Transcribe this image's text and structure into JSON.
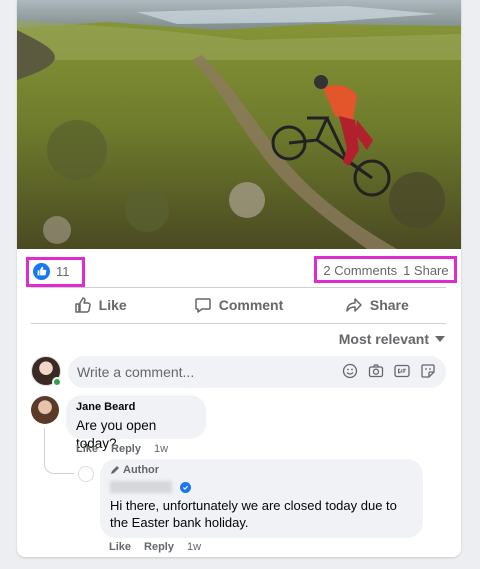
{
  "post": {
    "photo_alt": "Mountain biker on hillside trail",
    "like_count": "11",
    "comments_count": "2 Comments",
    "shares_count": "1 Share"
  },
  "actions": {
    "like": "Like",
    "comment": "Comment",
    "share": "Share"
  },
  "sort": {
    "label": "Most relevant"
  },
  "composer": {
    "placeholder": "Write a comment...",
    "icons": [
      "emoji-icon",
      "camera-icon",
      "gif-icon",
      "sticker-icon"
    ]
  },
  "comments": [
    {
      "author": "Jane Beard",
      "text": "Are you open today?",
      "like_label": "Like",
      "reply_label": "Reply",
      "time": "1w"
    }
  ],
  "reply": {
    "tag": "Author",
    "text": "Hi there, unfortunately we are closed today due to the Easter bank holiday.",
    "like_label": "Like",
    "reply_label": "Reply",
    "time": "1w"
  },
  "colors": {
    "accent": "#1877f2",
    "highlight": "#e02bd1",
    "muted_text": "#65676b",
    "bubble_bg": "#f0f2f5"
  }
}
